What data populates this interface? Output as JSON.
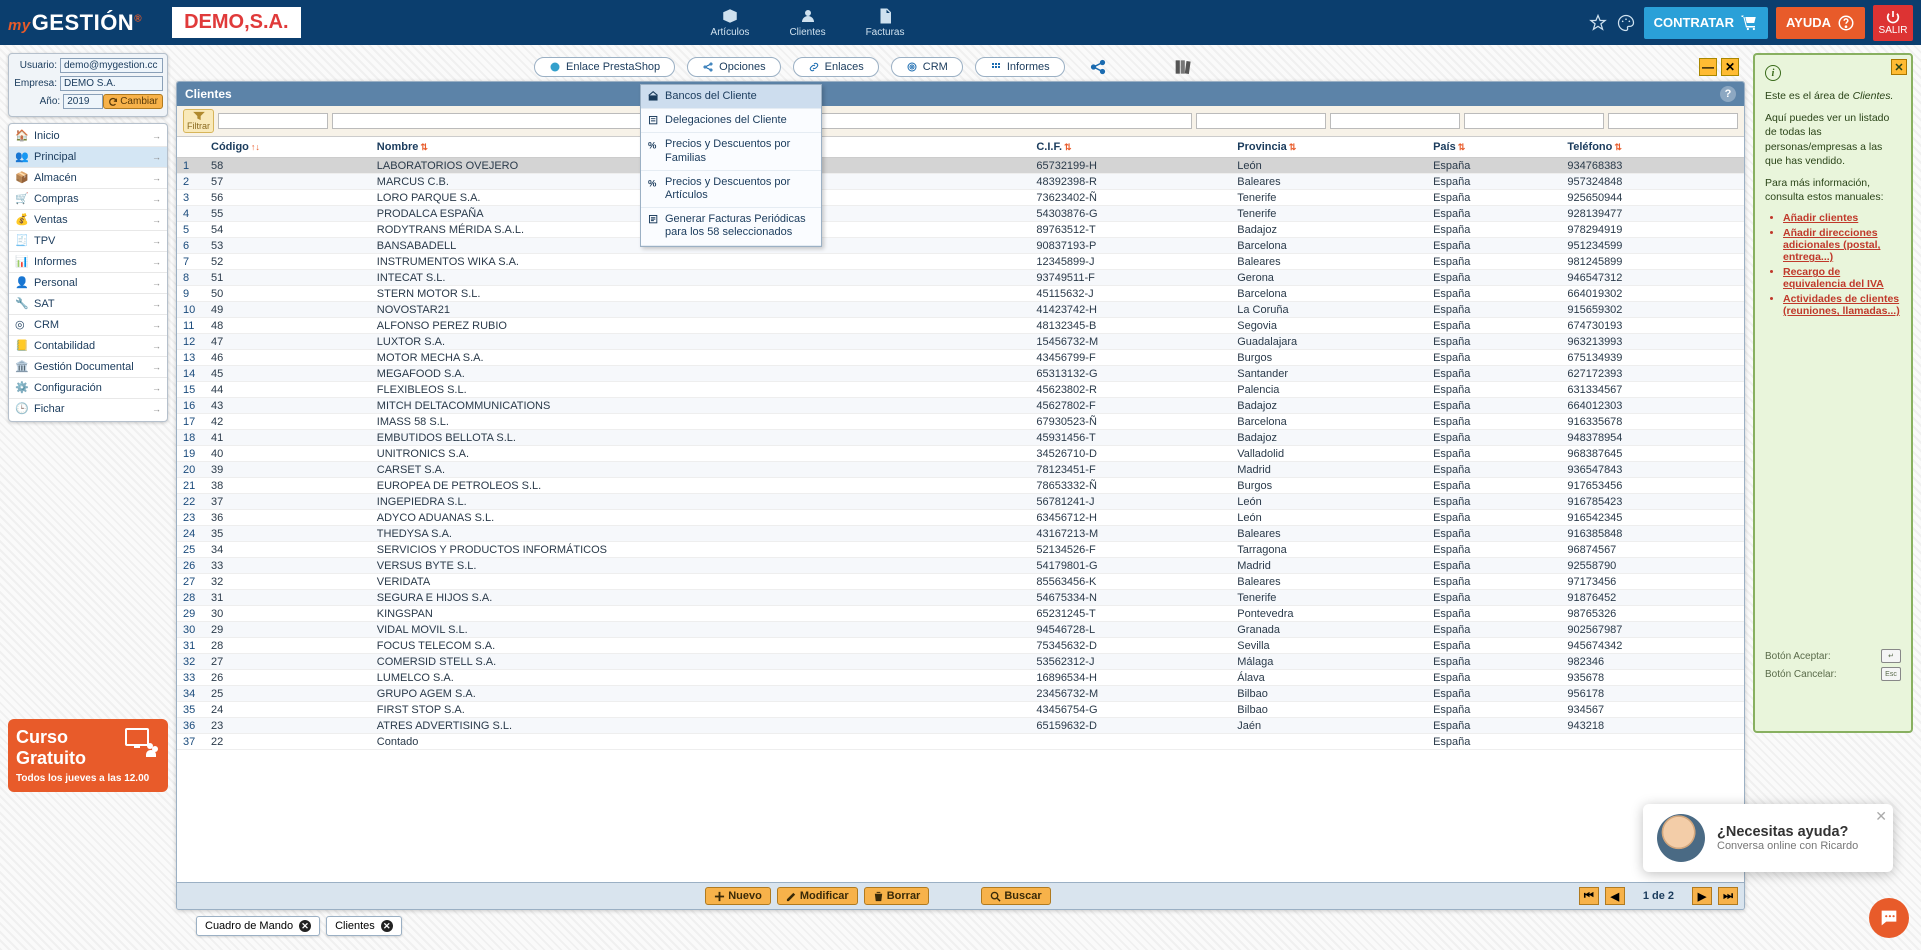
{
  "brand": {
    "my": "my",
    "name": "GESTIÓN",
    "reg": "®"
  },
  "company_badge": "DEMO,S.A.",
  "topnav": {
    "articulos": "Artículos",
    "clientes": "Clientes",
    "facturas": "Facturas"
  },
  "topbuttons": {
    "contratar": "CONTRATAR",
    "ayuda": "AYUDA",
    "salir": "SALIR"
  },
  "userpanel": {
    "usuario_lbl": "Usuario:",
    "usuario": "demo@mygestion.cc",
    "empresa_lbl": "Empresa:",
    "empresa": "DEMO S.A.",
    "ano_lbl": "Año:",
    "ano": "2019",
    "cambiar": "Cambiar"
  },
  "nav": {
    "items": [
      {
        "label": "Inicio"
      },
      {
        "label": "Principal"
      },
      {
        "label": "Almacén"
      },
      {
        "label": "Compras"
      },
      {
        "label": "Ventas"
      },
      {
        "label": "TPV"
      },
      {
        "label": "Informes"
      },
      {
        "label": "Personal"
      },
      {
        "label": "SAT"
      },
      {
        "label": "CRM"
      },
      {
        "label": "Contabilidad"
      },
      {
        "label": "Gestión Documental"
      },
      {
        "label": "Configuración"
      },
      {
        "label": "Fichar"
      }
    ]
  },
  "promo": {
    "t1": "Curso",
    "t2": "Gratuito",
    "t3": "Todos los jueves a las 12.00"
  },
  "toolbar": {
    "enlace_ps": "Enlace PrestaShop",
    "opciones": "Opciones",
    "enlaces": "Enlaces",
    "crm": "CRM",
    "informes": "Informes"
  },
  "dropdown": {
    "items": [
      "Bancos del Cliente",
      "Delegaciones del Cliente",
      "Precios y Descuentos por Familias",
      "Precios y Descuentos por Artículos",
      "Generar Facturas Periódicas para los 58 seleccionados"
    ]
  },
  "panel": {
    "title": "Clientes",
    "filter_label": "Filtrar",
    "columns": {
      "codigo": "Código",
      "nombre": "Nombre",
      "cif": "C.I.F.",
      "provincia": "Provincia",
      "pais": "País",
      "telefono": "Teléfono"
    },
    "rows": [
      {
        "n": 1,
        "codigo": "58",
        "nombre": "LABORATORIOS OVEJERO",
        "cif": "65732199-H",
        "prov": "León",
        "pais": "España",
        "tel": "934768383"
      },
      {
        "n": 2,
        "codigo": "57",
        "nombre": "MARCUS C.B.",
        "cif": "48392398-R",
        "prov": "Baleares",
        "pais": "España",
        "tel": "957324848"
      },
      {
        "n": 3,
        "codigo": "56",
        "nombre": "LORO PARQUE S.A.",
        "cif": "73623402-Ñ",
        "prov": "Tenerife",
        "pais": "España",
        "tel": "925650944"
      },
      {
        "n": 4,
        "codigo": "55",
        "nombre": "PRODALCA ESPAÑA",
        "cif": "54303876-G",
        "prov": "Tenerife",
        "pais": "España",
        "tel": "928139477"
      },
      {
        "n": 5,
        "codigo": "54",
        "nombre": "RODYTRANS MÉRIDA S.A.L.",
        "cif": "89763512-T",
        "prov": "Badajoz",
        "pais": "España",
        "tel": "978294919"
      },
      {
        "n": 6,
        "codigo": "53",
        "nombre": "BANSABADELL",
        "cif": "90837193-P",
        "prov": "Barcelona",
        "pais": "España",
        "tel": "951234599"
      },
      {
        "n": 7,
        "codigo": "52",
        "nombre": "INSTRUMENTOS WIKA S.A.",
        "cif": "12345899-J",
        "prov": "Baleares",
        "pais": "España",
        "tel": "981245899"
      },
      {
        "n": 8,
        "codigo": "51",
        "nombre": "INTECAT S.L.",
        "cif": "93749511-F",
        "prov": "Gerona",
        "pais": "España",
        "tel": "946547312"
      },
      {
        "n": 9,
        "codigo": "50",
        "nombre": "STERN MOTOR S.L.",
        "cif": "45115632-J",
        "prov": "Barcelona",
        "pais": "España",
        "tel": "664019302"
      },
      {
        "n": 10,
        "codigo": "49",
        "nombre": "NOVOSTAR21",
        "cif": "41423742-H",
        "prov": "La Coruña",
        "pais": "España",
        "tel": "915659302"
      },
      {
        "n": 11,
        "codigo": "48",
        "nombre": "ALFONSO PEREZ RUBIO",
        "cif": "48132345-B",
        "prov": "Segovia",
        "pais": "España",
        "tel": "674730193"
      },
      {
        "n": 12,
        "codigo": "47",
        "nombre": "LUXTOR S.A.",
        "cif": "15456732-M",
        "prov": "Guadalajara",
        "pais": "España",
        "tel": "963213993"
      },
      {
        "n": 13,
        "codigo": "46",
        "nombre": "MOTOR MECHA S.A.",
        "cif": "43456799-F",
        "prov": "Burgos",
        "pais": "España",
        "tel": "675134939"
      },
      {
        "n": 14,
        "codigo": "45",
        "nombre": "MEGAFOOD S.A.",
        "cif": "65313132-G",
        "prov": "Santander",
        "pais": "España",
        "tel": "627172393"
      },
      {
        "n": 15,
        "codigo": "44",
        "nombre": "FLEXIBLEOS S.L.",
        "cif": "45623802-R",
        "prov": "Palencia",
        "pais": "España",
        "tel": "631334567"
      },
      {
        "n": 16,
        "codigo": "43",
        "nombre": "MITCH DELTACOMMUNICATIONS",
        "cif": "45627802-F",
        "prov": "Badajoz",
        "pais": "España",
        "tel": "664012303"
      },
      {
        "n": 17,
        "codigo": "42",
        "nombre": "IMASS 58 S.L.",
        "cif": "67930523-Ñ",
        "prov": "Barcelona",
        "pais": "España",
        "tel": "916335678"
      },
      {
        "n": 18,
        "codigo": "41",
        "nombre": "EMBUTIDOS BELLOTA S.L.",
        "cif": "45931456-T",
        "prov": "Badajoz",
        "pais": "España",
        "tel": "948378954"
      },
      {
        "n": 19,
        "codigo": "40",
        "nombre": "UNITRONICS S.A.",
        "cif": "34526710-D",
        "prov": "Valladolid",
        "pais": "España",
        "tel": "968387645"
      },
      {
        "n": 20,
        "codigo": "39",
        "nombre": "CARSET S.A.",
        "cif": "78123451-F",
        "prov": "Madrid",
        "pais": "España",
        "tel": "936547843"
      },
      {
        "n": 21,
        "codigo": "38",
        "nombre": "EUROPEA DE PETROLEOS S.L.",
        "cif": "78653332-Ñ",
        "prov": "Burgos",
        "pais": "España",
        "tel": "917653456"
      },
      {
        "n": 22,
        "codigo": "37",
        "nombre": "INGEPIEDRA S.L.",
        "cif": "56781241-J",
        "prov": "León",
        "pais": "España",
        "tel": "916785423"
      },
      {
        "n": 23,
        "codigo": "36",
        "nombre": "ADYCO ADUANAS S.L.",
        "cif": "63456712-H",
        "prov": "León",
        "pais": "España",
        "tel": "916542345"
      },
      {
        "n": 24,
        "codigo": "35",
        "nombre": "THEDYSA S.A.",
        "cif": "43167213-M",
        "prov": "Baleares",
        "pais": "España",
        "tel": "916385848"
      },
      {
        "n": 25,
        "codigo": "34",
        "nombre": "SERVICIOS Y PRODUCTOS INFORMÁTICOS",
        "cif": "52134526-F",
        "prov": "Tarragona",
        "pais": "España",
        "tel": "96874567"
      },
      {
        "n": 26,
        "codigo": "33",
        "nombre": "VERSUS BYTE S.L.",
        "cif": "54179801-G",
        "prov": "Madrid",
        "pais": "España",
        "tel": "92558790"
      },
      {
        "n": 27,
        "codigo": "32",
        "nombre": "VERIDATA",
        "cif": "85563456-K",
        "prov": "Baleares",
        "pais": "España",
        "tel": "97173456"
      },
      {
        "n": 28,
        "codigo": "31",
        "nombre": "SEGURA E HIJOS S.A.",
        "cif": "54675334-N",
        "prov": "Tenerife",
        "pais": "España",
        "tel": "91876452"
      },
      {
        "n": 29,
        "codigo": "30",
        "nombre": "KINGSPAN",
        "cif": "65231245-T",
        "prov": "Pontevedra",
        "pais": "España",
        "tel": "98765326"
      },
      {
        "n": 30,
        "codigo": "29",
        "nombre": "VIDAL MOVIL S.L.",
        "cif": "94546728-L",
        "prov": "Granada",
        "pais": "España",
        "tel": "902567987"
      },
      {
        "n": 31,
        "codigo": "28",
        "nombre": "FOCUS TELECOM S.A.",
        "cif": "75345632-D",
        "prov": "Sevilla",
        "pais": "España",
        "tel": "945674342"
      },
      {
        "n": 32,
        "codigo": "27",
        "nombre": "COMERSID STELL S.A.",
        "cif": "53562312-J",
        "prov": "Málaga",
        "pais": "España",
        "tel": "982346"
      },
      {
        "n": 33,
        "codigo": "26",
        "nombre": "LUMELCO S.A.",
        "cif": "16896534-H",
        "prov": "Álava",
        "pais": "España",
        "tel": "935678"
      },
      {
        "n": 34,
        "codigo": "25",
        "nombre": "GRUPO AGEM S.A.",
        "cif": "23456732-M",
        "prov": "Bilbao",
        "pais": "España",
        "tel": "956178"
      },
      {
        "n": 35,
        "codigo": "24",
        "nombre": "FIRST STOP S.A.",
        "cif": "43456754-G",
        "prov": "Bilbao",
        "pais": "España",
        "tel": "934567"
      },
      {
        "n": 36,
        "codigo": "23",
        "nombre": "ATRES ADVERTISING S.L.",
        "cif": "65159632-D",
        "prov": "Jaén",
        "pais": "España",
        "tel": "943218"
      },
      {
        "n": 37,
        "codigo": "22",
        "nombre": "Contado",
        "cif": "",
        "prov": "",
        "pais": "España",
        "tel": ""
      }
    ],
    "footer": {
      "nuevo": "Nuevo",
      "modificar": "Modificar",
      "borrar": "Borrar",
      "buscar": "Buscar",
      "page": "1 de 2"
    }
  },
  "tabs": {
    "t1": "Cuadro de Mando",
    "t2": "Clientes"
  },
  "help": {
    "l1": "Este es el área de ",
    "l1b": "Clientes.",
    "p2": "Aquí puedes ver un listado de todas las personas/empresas a las que has vendido.",
    "p3": "Para más información, consulta estos manuales:",
    "links": [
      "Añadir clientes",
      "Añadir direcciones adicionales (postal, entrega...)",
      "Recargo de equivalencia del IVA",
      "Actividades de clientes (reuniones, llamadas...)"
    ],
    "k1": "Botón Aceptar:",
    "k2": "Botón Cancelar:"
  },
  "chat": {
    "t1": "¿Necesitas ayuda?",
    "t2": "Conversa online con Ricardo"
  }
}
